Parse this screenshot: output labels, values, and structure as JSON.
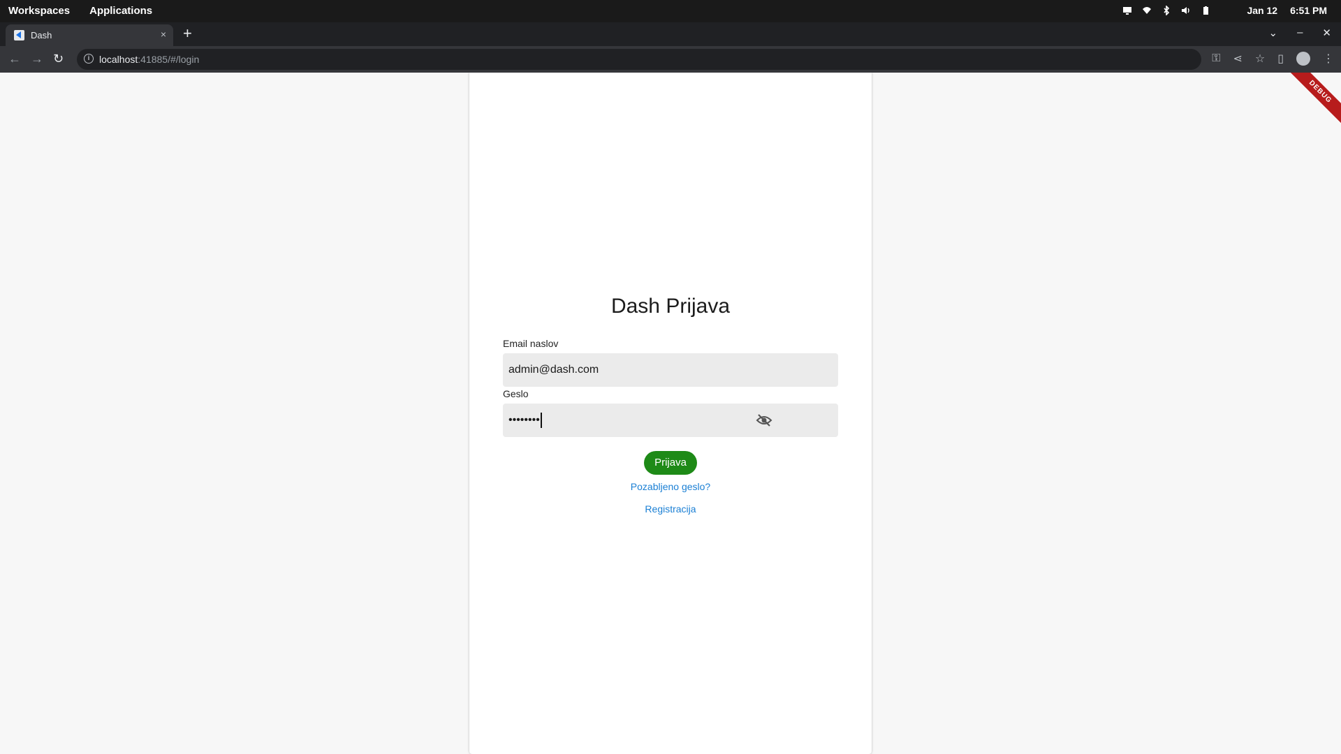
{
  "os_bar": {
    "workspaces": "Workspaces",
    "applications": "Applications",
    "date": "Jan 12",
    "time": "6:51 PM"
  },
  "browser": {
    "tab_title": "Dash",
    "tab_close": "×",
    "new_tab": "+",
    "url_host": "localhost",
    "url_rest": ":41885/#/login"
  },
  "page": {
    "title": "Dash Prijava",
    "email_label": "Email naslov",
    "email_value": "admin@dash.com",
    "password_label": "Geslo",
    "password_value": "••••••••",
    "login_button": "Prijava",
    "forgot_link": "Pozabljeno geslo?",
    "register_link": "Registracija",
    "debug_banner": "DEBUG"
  },
  "colors": {
    "primary_green": "#1e8a17",
    "link_blue": "#1a7fd4"
  }
}
